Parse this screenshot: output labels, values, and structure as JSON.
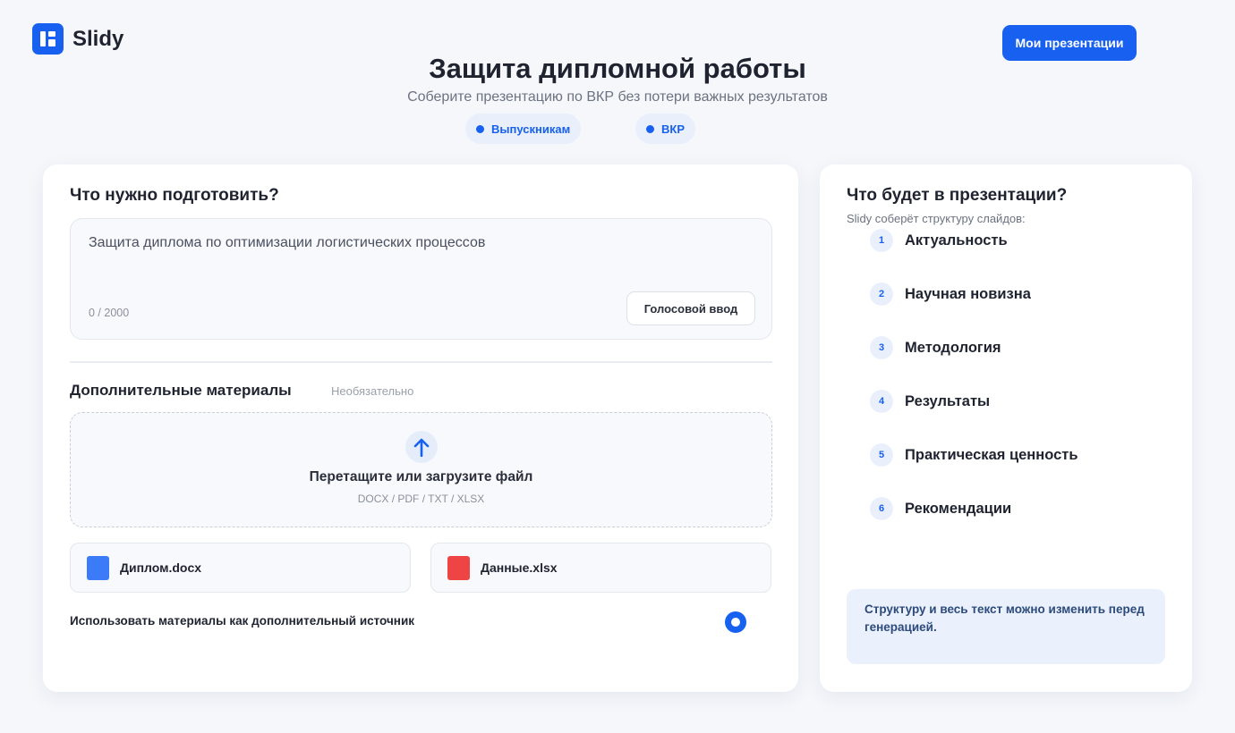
{
  "app": {
    "name": "Slidy"
  },
  "header": {
    "my_presentations_label": "Мои презентации"
  },
  "hero": {
    "title": "Защита дипломной работы",
    "subtitle": "Соберите презентацию по ВКР без потери важных результатов",
    "tags": [
      "Выпускникам",
      "ВКР"
    ]
  },
  "form": {
    "section_title": "Что нужно подготовить?",
    "prompt_text": "Защита диплома по оптимизации логистических процессов",
    "counter": "0 / 2000",
    "voice_button_label": "Голосовой ввод",
    "materials_title": "Дополнительные материалы",
    "materials_optional": "Необязательно",
    "dropzone_title": "Перетащите или загрузите файл",
    "dropzone_formats": "DOCX / PDF / TXT / XLSX",
    "files": [
      {
        "name": "Диплом.docx",
        "color": "#3b7bf7"
      },
      {
        "name": "Данные.xlsx",
        "color": "#ef4444"
      }
    ],
    "use_materials_label": "Использовать материалы как дополнительный источник",
    "use_materials_checked": true
  },
  "preview": {
    "title": "Что будет в презентации?",
    "subtitle": "Slidy соберёт структуру слайдов:",
    "slides": [
      {
        "num": "1",
        "label": "Актуальность"
      },
      {
        "num": "2",
        "label": "Научная новизна"
      },
      {
        "num": "3",
        "label": "Методология"
      },
      {
        "num": "4",
        "label": "Результаты"
      },
      {
        "num": "5",
        "label": "Практическая ценность"
      },
      {
        "num": "6",
        "label": "Рекомендации"
      }
    ],
    "note": "Структуру и весь текст можно изменить перед генерацией."
  },
  "colors": {
    "accent": "#1760f0",
    "tag_bg": "#eaf0fb",
    "note_bg": "#eaf1fd"
  }
}
